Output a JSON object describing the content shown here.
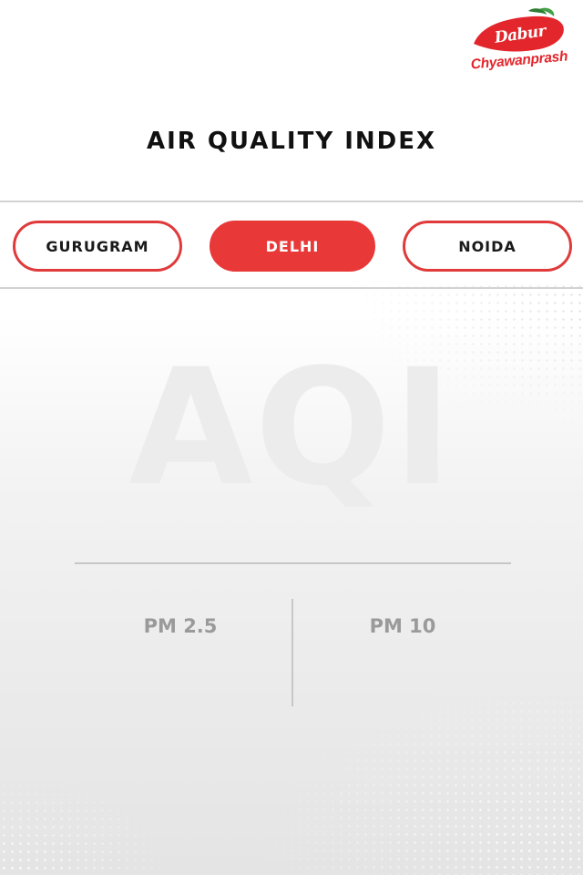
{
  "brand": {
    "name": "Dabur",
    "product": "Chyawanprash",
    "color": "#e3262c"
  },
  "page": {
    "title": "AIR QUALITY INDEX",
    "watermark": "AQI"
  },
  "cities": [
    {
      "label": "GURUGRAM",
      "selected": false
    },
    {
      "label": "DELHI",
      "selected": true
    },
    {
      "label": "NOIDA",
      "selected": false
    }
  ],
  "metrics": {
    "pm25_label": "PM 2.5",
    "pm10_label": "PM 10"
  },
  "colors": {
    "accent": "#e93838",
    "text": "#111111",
    "muted": "#9a9a9a"
  }
}
